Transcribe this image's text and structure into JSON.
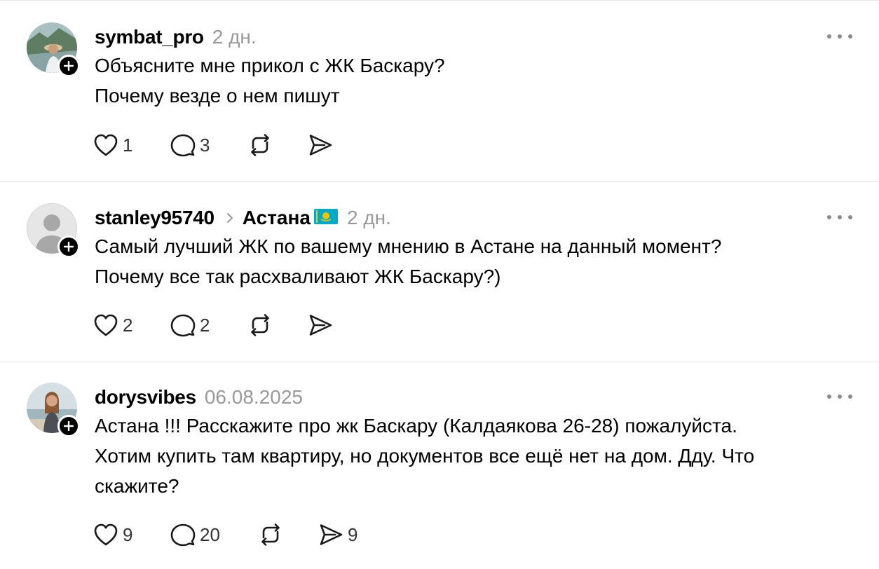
{
  "posts": [
    {
      "username": "symbat_pro",
      "time": "2 дн.",
      "lines": [
        "Объясните мне прикол с ЖК Баскару?",
        "Почему везде о нем пишут"
      ],
      "likes": "1",
      "replies": "3",
      "reposts": "",
      "shares": ""
    },
    {
      "username": "stanley95740",
      "topic": "Астана",
      "flag_icon": "kazakhstan-flag-icon",
      "time": "2 дн.",
      "lines": [
        "Самый лучший ЖК по вашему мнению в Астане на данный момент?",
        "Почему все так расхваливают ЖК Баскару?)"
      ],
      "likes": "2",
      "replies": "2",
      "reposts": "",
      "shares": ""
    },
    {
      "username": "dorysvibes",
      "time": "06.08.2025",
      "lines": [
        "Астана !!! Расскажите про жк Баскару (Калдаякова 26-28) пожалуйста.",
        "Хотим купить там квартиру, но документов все ещё нет на дом. Дду. Что",
        "скажите?"
      ],
      "likes": "9",
      "replies": "20",
      "reposts": "",
      "shares": "9"
    }
  ],
  "icons": {
    "like": "heart-icon",
    "reply": "comment-bubble-icon",
    "repost": "repost-arrows-icon",
    "share": "send-icon",
    "more": "more-dots-icon",
    "follow": "plus-icon"
  },
  "colors": {
    "text": "#000000",
    "muted": "#999999",
    "divider": "#e3e3e3"
  }
}
